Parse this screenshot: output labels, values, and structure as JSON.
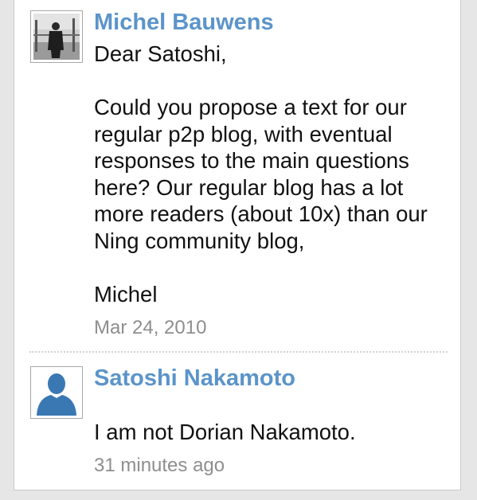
{
  "comments": [
    {
      "author": "Michel Bauwens",
      "body": "Dear Satoshi,\n\nCould you propose a text for our regular p2p blog, with eventual responses to the main questions here? Our regular blog has a lot more readers (about 10x) than our Ning community blog,\n\nMichel",
      "timestamp": "Mar 24, 2010",
      "avatar": "user-photo"
    },
    {
      "author": "Satoshi Nakamoto",
      "body": "I am not Dorian Nakamoto.",
      "timestamp": "31 minutes ago",
      "avatar": "default-user-silhouette-icon"
    }
  ],
  "colors": {
    "author_link": "#5b94c9",
    "timestamp": "#8e8e8e",
    "avatar_placeholder": "#3a78b3"
  }
}
